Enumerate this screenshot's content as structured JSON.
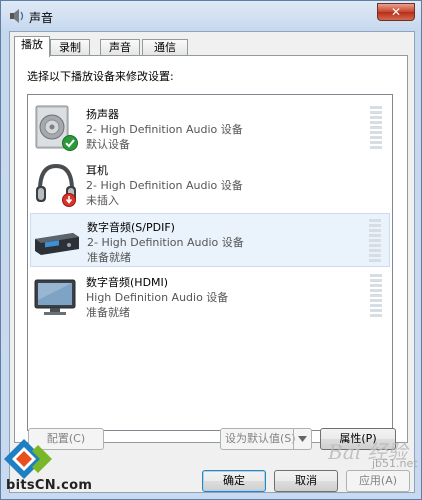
{
  "window": {
    "title": "声音",
    "close_label": "✕"
  },
  "tabs": [
    {
      "label": "播放",
      "active": true
    },
    {
      "label": "录制",
      "active": false
    },
    {
      "label": "声音",
      "active": false
    },
    {
      "label": "通信",
      "active": false
    }
  ],
  "panel": {
    "instruction": "选择以下播放设备来修改设置:"
  },
  "devices": [
    {
      "name": "扬声器",
      "desc": "2- High Definition Audio 设备",
      "status": "默认设备",
      "icon": "speaker-icon",
      "badge": "default-check-icon"
    },
    {
      "name": "耳机",
      "desc": "2- High Definition Audio 设备",
      "status": "未插入",
      "icon": "headphones-icon",
      "badge": "unplugged-icon"
    },
    {
      "name": "数字音频(S/PDIF)",
      "desc": "2- High Definition Audio 设备",
      "status": "准备就绪",
      "icon": "digital-audio-icon",
      "selected": true
    },
    {
      "name": "数字音频(HDMI)",
      "desc": "High Definition Audio 设备",
      "status": "准备就绪",
      "icon": "monitor-icon"
    }
  ],
  "buttons": {
    "configure": "配置(C)",
    "set_default": "设为默认值(S)",
    "properties": "属性(P)",
    "ok": "确定",
    "cancel": "取消",
    "apply": "应用(A)"
  },
  "watermarks": {
    "bitscn": "bitsCN.com",
    "baidu": "Bai 经验",
    "jb51": "jb51.net"
  }
}
